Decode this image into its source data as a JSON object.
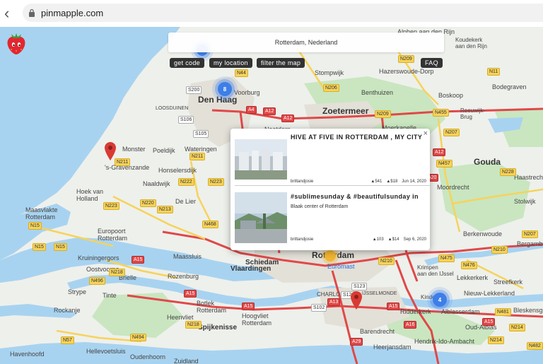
{
  "browser": {
    "url": "pinmapple.com",
    "back_icon": "chevron-left-icon",
    "lock_icon": "lock-icon"
  },
  "search": {
    "value": "Rotterdam, Nederland"
  },
  "buttons": {
    "get_code": "get code",
    "my_location": "my location",
    "filter": "filter the map",
    "faq": "FAQ"
  },
  "clusters": [
    {
      "count": "8"
    },
    {
      "count": "4"
    }
  ],
  "popup": {
    "close": "×",
    "posts": [
      {
        "title": "HIVE AT FIVE IN ROTTERDAM , MY CITY",
        "subtitle": "",
        "user": "brittandjosie",
        "votes": "▲541",
        "payout": "▲$18",
        "date": "Jun 14, 2020"
      },
      {
        "title": "#sublimesunday & #beautifulsunday in",
        "subtitle": "Blaak center of Rotterdam",
        "user": "brittandjosie",
        "votes": "▲103",
        "payout": "▲$14",
        "date": "Sep 6, 2020"
      }
    ]
  },
  "map": {
    "cities": {
      "den_haag": "Den Haag",
      "zoetermeer": "Zoetermeer",
      "rotterdam": "Rotterdam",
      "gouda": "Gouda",
      "schiedam": "Schiedam",
      "vlaardingen": "Vlaardingen",
      "spijkenisse": "Spijkenisse"
    },
    "towns": {
      "voorburg": "Voorburg",
      "monster": "Monster",
      "poeldijk": "Poeldijk",
      "wateringen": "Wateringen",
      "s_gravenzande": "'s-Gravenzande",
      "honselersdijk": "Honselersdijk",
      "naaldwijk": "Naaldwijk",
      "hoek_van_holland": "Hoek van\nHolland",
      "de_lier": "De Lier",
      "maasvlakte": "Maasvlakte\nRotterdam",
      "europoort": "Europoort\nRotterdam",
      "maassluis": "Maassluis",
      "kruiningergors": "Kruiningergors",
      "oostvoorne": "Oostvoorne",
      "rozenburg": "Rozenburg",
      "brielle": "Brielle",
      "strype": "Strype",
      "tinte": "Tinte",
      "rockanje": "Rockanje",
      "botlek": "Botlek\nRotterdam",
      "hoogvliet": "Hoogvliet\nRotterdam",
      "heenvliet": "Heenvliet",
      "hellevoetsluis": "Hellevoetsluis",
      "havenhoofd": "Havenhoofd",
      "oudenhoorn": "Oudenhoorn",
      "zuidland": "Zuidland",
      "charlois": "CHARLOIS",
      "ijsselmonde": "IJSSELMONDE",
      "barendrecht": "Barendrecht",
      "ridderkerk": "Ridderkerk",
      "heerjansdam": "Heerjansdam",
      "hendrik_ido": "Hendrik-Ido-Ambacht",
      "alblasserdam": "Alblasserdam",
      "oud_alblas": "Oud-Alblas",
      "nieuw_lekkerland": "Nieuw-Lekkerland",
      "bleskensgraaf": "Bleskensgraaf",
      "streefkerk": "Streefkerk",
      "lekkerkerk": "Lekkerkerk",
      "berkenwoude": "Berkenwoude",
      "bergambacht": "Bergambacht",
      "moordrecht": "Moordrecht",
      "haastrecht": "Haastrecht",
      "stolwijk": "Stolwijk",
      "reeuwijk": "Reeuwijk",
      "boskoop": "Boskoop",
      "bodegraven": "Bodegraven",
      "benthuizen": "Benthuizen",
      "hazerswoude": "Hazerswoude-Dorp",
      "stompwijk": "Stompwijk",
      "koudekerk": "Koudekerk\naan den Rijn",
      "alphen": "Alphen aan den Rijn",
      "krimpen": "Krimpen\naan den IJssel",
      "kinderdijk": "Kinderdijk",
      "euromast": "Euromast",
      "loosduinen": "LOOSDUINEN",
      "nootdorp": "Nootdorp",
      "moerkapelle": "Moerkapelle",
      "reeuwijk_brug": "Reeuwijk-\nBrug"
    },
    "roads": {
      "a4": "A4",
      "a12": "A12",
      "a13": "A13",
      "a15": "A15",
      "a16": "A16",
      "a20": "A20",
      "a29": "A29",
      "n44": "N44",
      "n11": "N11",
      "n206": "N206",
      "n209": "N209",
      "n207": "N207",
      "n211": "N211",
      "n220": "N220",
      "n213": "N213",
      "n222": "N222",
      "n223": "N223",
      "n15": "N15",
      "n218": "N218",
      "n496": "N496",
      "n57": "N57",
      "n494": "N494",
      "n468": "N468",
      "n228": "N228",
      "n455": "N455",
      "n457": "N457",
      "n210": "N210",
      "n475": "N475",
      "n476": "N476",
      "n481": "N481",
      "n214": "N214",
      "n482": "N482",
      "s200": "S200",
      "s106": "S106",
      "s105": "S105",
      "s102": "S102",
      "s123": "S123",
      "s125": "S125"
    }
  },
  "colors": {
    "water": "#a8d3f0",
    "land": "#eef0ec",
    "green": "#c9e6c0",
    "motorway": "#e04848",
    "road": "#f6d35a",
    "cluster": "#3d7ee8",
    "pin": "#d93a33"
  }
}
